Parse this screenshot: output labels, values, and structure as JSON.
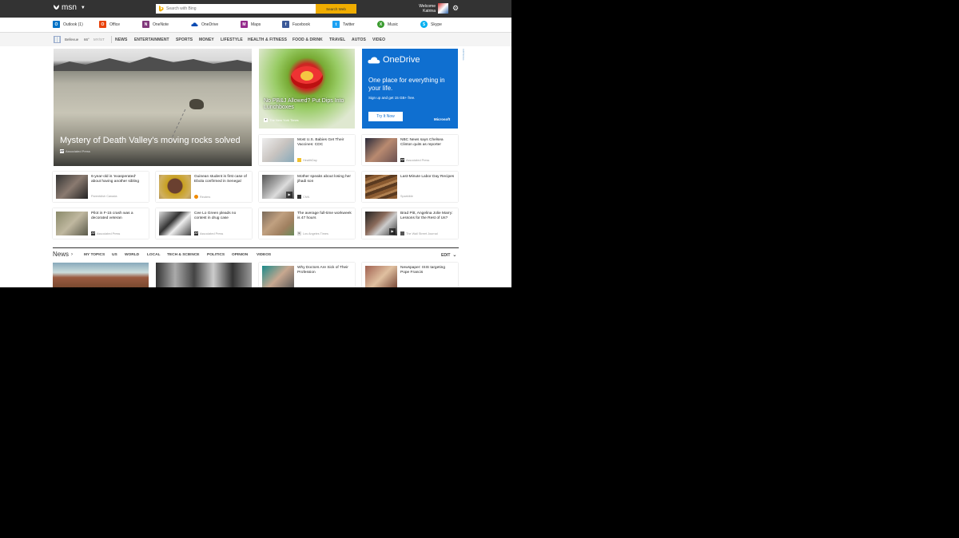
{
  "header": {
    "logo": "msn",
    "search_placeholder": "Search with Bing",
    "search_button": "Search Web",
    "welcome": "Welcome",
    "user": "Katrina"
  },
  "apps": [
    {
      "label": "Outlook (1)",
      "icon": "outlook-icon",
      "color": "#0072c6"
    },
    {
      "label": "Office",
      "icon": "office-icon",
      "color": "#e8430c"
    },
    {
      "label": "OneNote",
      "icon": "onenote-icon",
      "color": "#80397b"
    },
    {
      "label": "OneDrive",
      "icon": "onedrive-icon",
      "color": "#094ab2"
    },
    {
      "label": "Maps",
      "icon": "maps-icon",
      "color": "#952b8c"
    },
    {
      "label": "Facebook",
      "icon": "facebook-icon",
      "color": "#3b5998"
    },
    {
      "label": "Twitter",
      "icon": "twitter-icon",
      "color": "#1da1f2"
    },
    {
      "label": "Music",
      "icon": "music-icon",
      "color": "#3a9b2f"
    },
    {
      "label": "Skype",
      "icon": "skype-icon",
      "color": "#00aff0"
    }
  ],
  "weather": {
    "city": "Bellevue",
    "temp": "66°",
    "myst": "MY/ST"
  },
  "categories": [
    "NEWS",
    "ENTERTAINMENT",
    "SPORTS",
    "MONEY",
    "LIFESTYLE",
    "HEALTH & FITNESS",
    "FOOD & DRINK",
    "TRAVEL",
    "AUTOS",
    "VIDEO"
  ],
  "hero": {
    "title": "Mystery of Death Valley's moving rocks solved",
    "source": "Associated Press"
  },
  "featured2": {
    "title": "No PB&J Allowed? Put Dips Into Lunchboxes",
    "source": "The New York Times"
  },
  "ad": {
    "logo": "OneDrive",
    "headline": "One place for everything in your life.",
    "sub": "Sign up and get 15 GB+ free.",
    "button": "Try It Now",
    "brand": "Microsoft",
    "adchoices": "AdChoices"
  },
  "cards": [
    {
      "title": "Most U.S. Babies Get Their Vaccines: CDC",
      "source": "HealthDay"
    },
    {
      "title": "NBC News says Chelsea Clinton quits as reporter",
      "source": "Associated Press"
    },
    {
      "title": "6-year-old is 'exasperated' about having another sibling",
      "source": "Parentdish Canada"
    },
    {
      "title": "Guinean student is first case of Ebola confirmed in Senegal",
      "source": "Reuters"
    },
    {
      "title": "Mother speaks about losing her jihadi son",
      "source": "CNN"
    },
    {
      "title": "Last-Minute Labor Day Recipes",
      "source": "Sparkible"
    },
    {
      "title": "Pilot in F-15 crash was a decorated veteran",
      "source": "Associated Press"
    },
    {
      "title": "Cee Lo Green pleads no contest in drug case",
      "source": "Associated Press"
    },
    {
      "title": "The average full-time workweek is 47 hours",
      "source": "Los Angeles Times"
    },
    {
      "title": "Brad Pitt, Angelina Jolie Marry: Lessons for the Rest of Us?",
      "source": "The Wall Street Journal"
    }
  ],
  "news": {
    "heading": "News",
    "tabs": [
      "MY TOPICS",
      "US",
      "WORLD",
      "LOCAL",
      "TECH & SCIENCE",
      "POLITICS",
      "OPINION",
      "VIDEOS"
    ],
    "edit": "EDIT",
    "cards": [
      {
        "title": "Why Doctors Are Sick of Their Profession"
      },
      {
        "title": "Newspaper: ISIS targeting Pope Francis"
      }
    ]
  }
}
